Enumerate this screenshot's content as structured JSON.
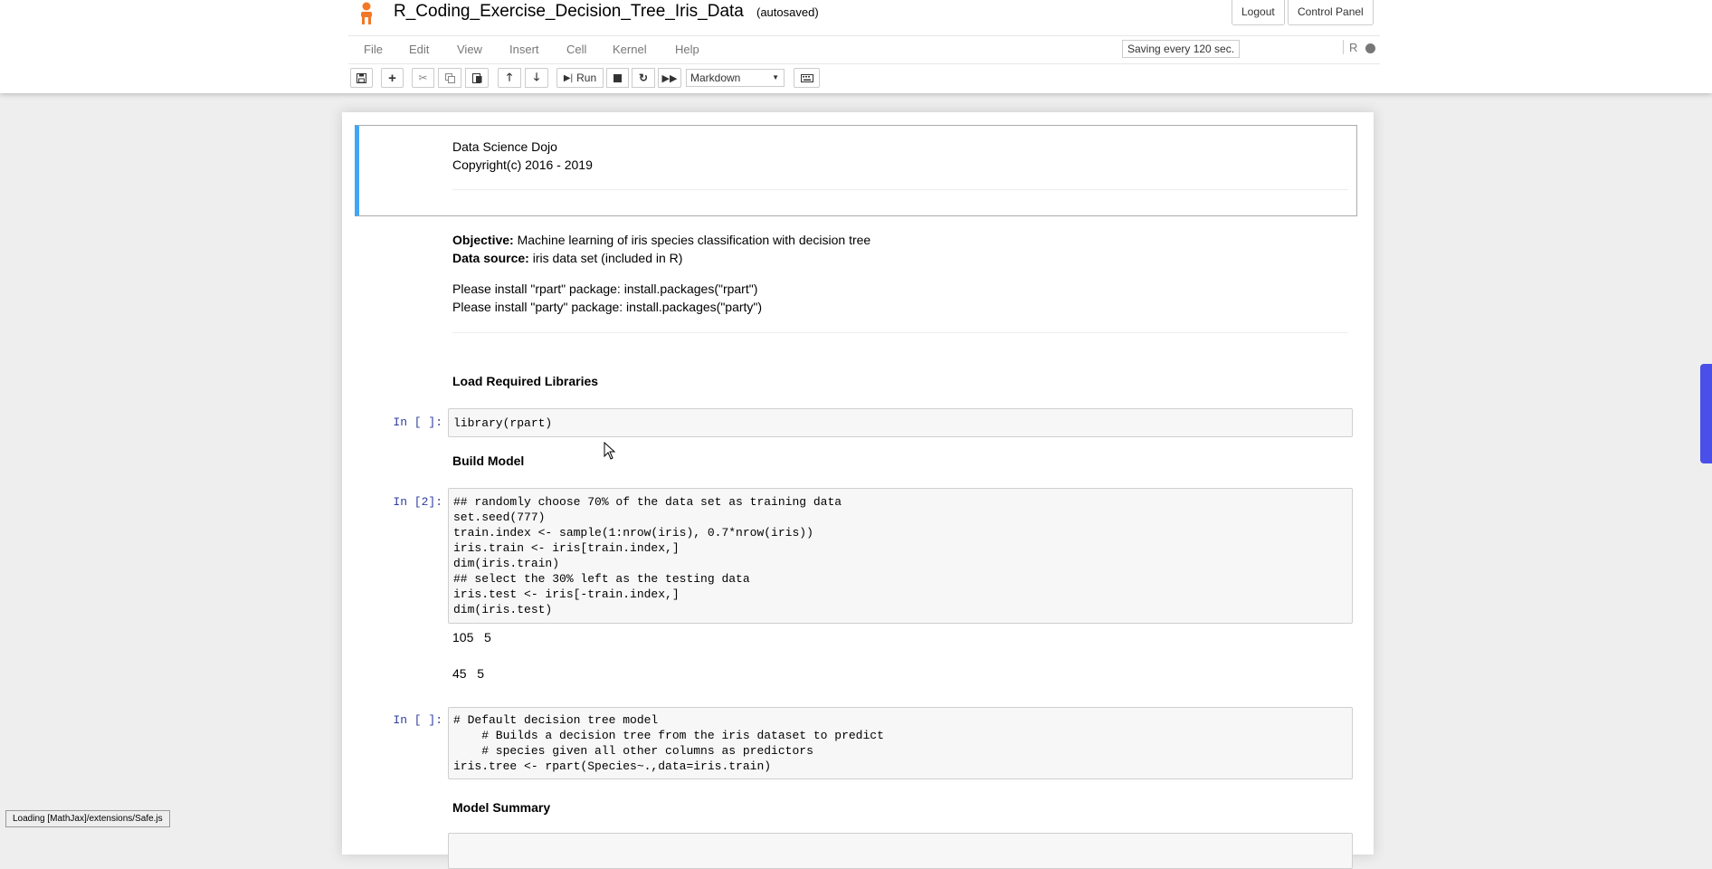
{
  "header": {
    "title": "R_Coding_Exercise_Decision_Tree_Iris_Data",
    "autosave": "(autosaved)",
    "logout_label": "Logout",
    "control_panel_label": "Control Panel"
  },
  "menu": [
    "File",
    "Edit",
    "View",
    "Insert",
    "Cell",
    "Kernel",
    "Help"
  ],
  "saving_indicator": "Saving every 120 sec.",
  "kernel_name": "R",
  "toolbar": {
    "run_label": "Run",
    "cell_type": "Markdown"
  },
  "cells": {
    "header_md": {
      "lines": [
        "Data Science Dojo",
        "Copyright(c) 2016 - 2019"
      ]
    },
    "objective_md": {
      "objective_label": "Objective:",
      "objective_text": " Machine learning of iris species classification with decision tree",
      "source_label": "Data source:",
      "source_text": " iris data set (included in R)",
      "install1": "Please install \"rpart\" package: install.packages(\"rpart\")",
      "install2": "Please install \"party\" package: install.packages(\"party\")"
    },
    "heading_load": "Load Required Libraries",
    "code1": {
      "prompt": "In [ ]:",
      "lines": [
        "library(rpart)"
      ]
    },
    "heading_build": "Build Model",
    "code2": {
      "prompt": "In [2]:",
      "lines": [
        "## randomly choose 70% of the data set as training data",
        "set.seed(777)",
        "train.index <- sample(1:nrow(iris), 0.7*nrow(iris))",
        "iris.train <- iris[train.index,]",
        "dim(iris.train)",
        "## select the 30% left as the testing data",
        "iris.test <- iris[-train.index,]",
        "dim(iris.test)"
      ],
      "outputs": [
        "105   5",
        "45   5"
      ]
    },
    "code3": {
      "prompt": "In [ ]:",
      "lines": [
        "# Default decision tree model",
        "    # Builds a decision tree from the iris dataset to predict",
        "    # species given all other columns as predictors",
        "iris.tree <- rpart(Species~.,data=iris.train)"
      ]
    },
    "heading_summary": "Model Summary"
  },
  "status_bar": "Loading [MathJax]/extensions/Safe.js",
  "colors": {
    "selected_cell_border": "#42a5f5",
    "prompt": "#303f9f",
    "side_tab": "#4a4fe8"
  }
}
